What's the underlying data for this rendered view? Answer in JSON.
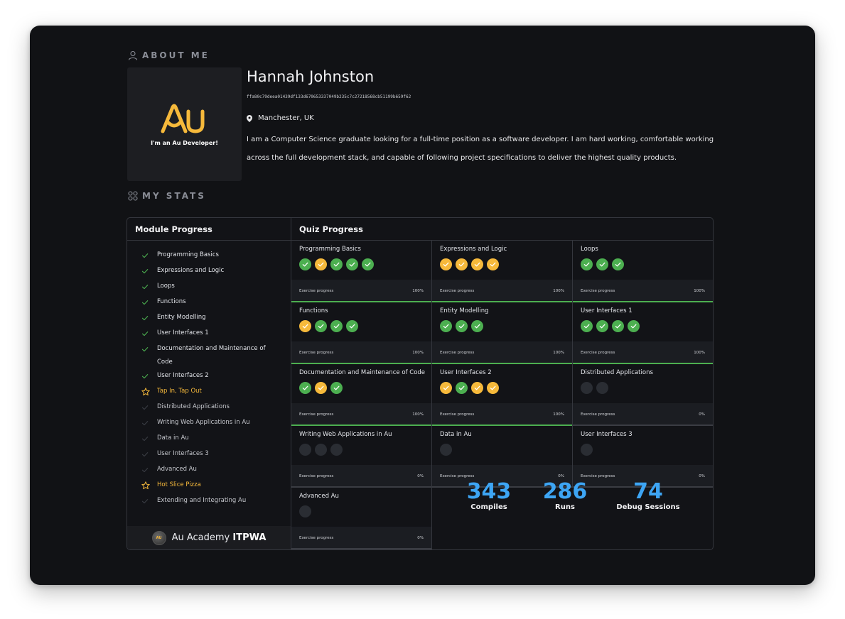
{
  "about": {
    "heading": "ABOUT ME",
    "name": "Hannah Johnston",
    "hash": "ffa80c79deea01439df133d670653337049b235c7c27218568cb51199b659f62",
    "location": "Manchester, UK",
    "bio": "I am a Computer Science graduate looking for a full-time position as a software developer. I am hard working, comfortable working across the full development stack, and capable of following project specifications to deliver the highest quality products.",
    "avatar_logo": "Au",
    "avatar_tagline": "I'm an Au Developer!"
  },
  "stats": {
    "heading": "MY STATS",
    "module_header": "Module Progress",
    "quiz_header": "Quiz Progress",
    "modules": [
      {
        "label": "Programming Basics",
        "status": "done"
      },
      {
        "label": "Expressions and Logic",
        "status": "done"
      },
      {
        "label": "Loops",
        "status": "done"
      },
      {
        "label": "Functions",
        "status": "done"
      },
      {
        "label": "Entity Modelling",
        "status": "done"
      },
      {
        "label": "User Interfaces 1",
        "status": "done"
      },
      {
        "label": "Documentation and Maintenance of Code",
        "status": "done"
      },
      {
        "label": "User Interfaces 2",
        "status": "done"
      },
      {
        "label": "Tap In, Tap Out",
        "status": "special"
      },
      {
        "label": "Distributed Applications",
        "status": "pending"
      },
      {
        "label": "Writing Web Applications in Au",
        "status": "pending"
      },
      {
        "label": "Data in Au",
        "status": "pending"
      },
      {
        "label": "User Interfaces 3",
        "status": "pending"
      },
      {
        "label": "Advanced Au",
        "status": "pending"
      },
      {
        "label": "Hot Slice Pizza",
        "status": "special"
      },
      {
        "label": "Extending and Integrating Au",
        "status": "pending"
      }
    ],
    "progress_label": "Exercise progress",
    "quizzes": [
      {
        "title": "Programming Basics",
        "dots": [
          "green",
          "yellow",
          "green",
          "green",
          "green"
        ],
        "progress": "100%",
        "fraction": 1
      },
      {
        "title": "Expressions and Logic",
        "dots": [
          "yellow",
          "yellow",
          "yellow",
          "yellow"
        ],
        "progress": "100%",
        "fraction": 1
      },
      {
        "title": "Loops",
        "dots": [
          "green",
          "green",
          "green"
        ],
        "progress": "100%",
        "fraction": 1
      },
      {
        "title": "Functions",
        "dots": [
          "yellow",
          "green",
          "green",
          "green"
        ],
        "progress": "100%",
        "fraction": 1
      },
      {
        "title": "Entity Modelling",
        "dots": [
          "green",
          "green",
          "green"
        ],
        "progress": "100%",
        "fraction": 1
      },
      {
        "title": "User Interfaces 1",
        "dots": [
          "green",
          "green",
          "green",
          "green"
        ],
        "progress": "100%",
        "fraction": 1
      },
      {
        "title": "Documentation and Maintenance of Code",
        "dots": [
          "green",
          "yellow",
          "green"
        ],
        "progress": "100%",
        "fraction": 1
      },
      {
        "title": "User Interfaces 2",
        "dots": [
          "yellow",
          "green",
          "yellow",
          "yellow"
        ],
        "progress": "100%",
        "fraction": 1
      },
      {
        "title": "Distributed Applications",
        "dots": [
          "empty",
          "empty"
        ],
        "progress": "0%",
        "fraction": 0
      },
      {
        "title": "Writing Web Applications in Au",
        "dots": [
          "empty",
          "empty",
          "empty"
        ],
        "progress": "0%",
        "fraction": 0
      },
      {
        "title": "Data in Au",
        "dots": [
          "empty"
        ],
        "progress": "0%",
        "fraction": 0
      },
      {
        "title": "User Interfaces 3",
        "dots": [
          "empty"
        ],
        "progress": "0%",
        "fraction": 0
      },
      {
        "title": "Advanced Au",
        "dots": [
          "empty"
        ],
        "progress": "0%",
        "fraction": 0
      }
    ],
    "totals": [
      {
        "value": "343",
        "label": "Compiles"
      },
      {
        "value": "286",
        "label": "Runs"
      },
      {
        "value": "74",
        "label": "Debug Sessions"
      }
    ]
  },
  "brand": {
    "prefix": "Au Academy",
    "suffix": "ITPWA",
    "logo_text": "AU"
  },
  "colors": {
    "green": "#4caf50",
    "yellow": "#f6b93b",
    "accent_blue": "#3da5f4"
  }
}
